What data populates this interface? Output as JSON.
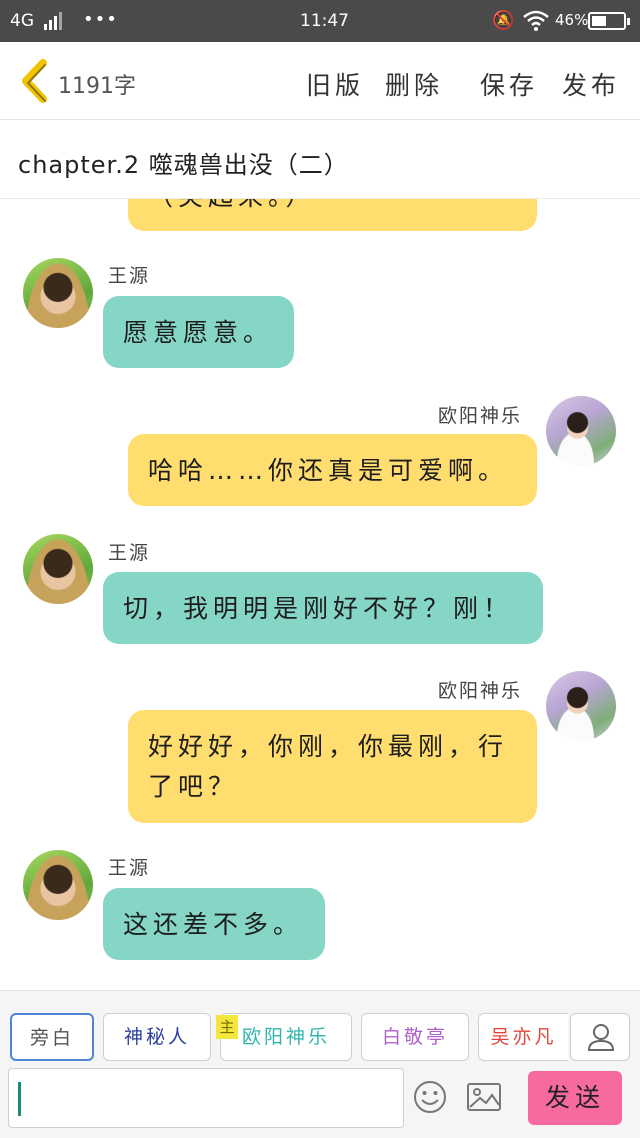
{
  "status_bar": {
    "network": "4G",
    "time": "11:47",
    "battery": "46%",
    "battery_level": 0.46
  },
  "header": {
    "word_count": "1191字",
    "old_version": "旧版",
    "delete": "删除",
    "save": "保存",
    "publish": "发布"
  },
  "chapter_title": "chapter.2 噬魂兽出没（二）",
  "messages": [
    {
      "side": "right",
      "speaker": "",
      "text": "（笑起来。）"
    },
    {
      "side": "left",
      "speaker": "王源",
      "text": "愿意愿意。"
    },
    {
      "side": "right",
      "speaker": "欧阳神乐",
      "text": "哈哈……你还真是可爱啊。"
    },
    {
      "side": "left",
      "speaker": "王源",
      "text": "切，我明明是刚好不好？刚！"
    },
    {
      "side": "right",
      "speaker": "欧阳神乐",
      "text": "好好好，你刚，你最刚，行了吧？"
    },
    {
      "side": "left",
      "speaker": "王源",
      "text": "这还差不多。"
    }
  ],
  "roles": [
    {
      "label": "旁白",
      "color": "#555555",
      "selected": true
    },
    {
      "label": "神秘人",
      "color": "#2a3f9e",
      "selected": false
    },
    {
      "label": "欧阳神乐",
      "color": "#2fb5ad",
      "selected": false,
      "tag": "主"
    },
    {
      "label": "白敬亭",
      "color": "#b261c8",
      "selected": false
    },
    {
      "label": "吴亦凡",
      "color": "#e0463b",
      "selected": false
    }
  ],
  "input": {
    "value": ""
  },
  "send_label": "发送",
  "colors": {
    "teal_bubble": "#86d6c8",
    "yellow_bubble": "#ffdd6e",
    "send": "#f76aa0",
    "back_arrow": "#f2c400"
  }
}
